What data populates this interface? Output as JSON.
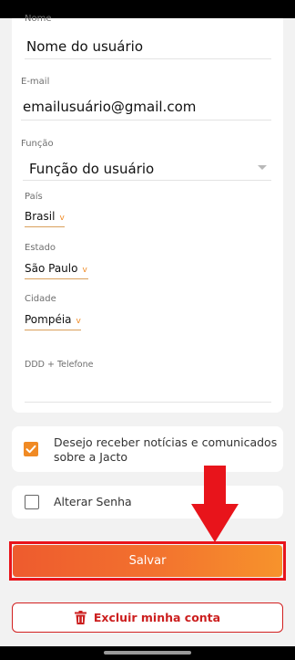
{
  "form": {
    "name_label": "Nome",
    "name_value": "Nome do usuário",
    "email_label": "E-mail",
    "email_value": "emailusuário@gmail.com",
    "role_label": "Função",
    "role_value": "Função do usuário",
    "country_label": "País",
    "country_value": "Brasil",
    "state_label": "Estado",
    "state_value": "São Paulo",
    "city_label": "Cidade",
    "city_value": "Pompéia",
    "phone_label": "DDD + Telefone",
    "phone_value": ""
  },
  "options": {
    "newsletter_text": "Desejo receber notícias e comunicados sobre a Jacto",
    "newsletter_checked": true,
    "change_password_text": "Alterar Senha",
    "change_password_checked": false
  },
  "actions": {
    "save_label": "Salvar",
    "delete_label": "Excluir minha conta"
  },
  "icons": {
    "caret": "v",
    "delete_icon": "trash-icon",
    "annotation_arrow": "down-arrow-icon"
  },
  "colors": {
    "accent": "#f08a24",
    "save_gradient_start": "#ee5b2e",
    "save_gradient_end": "#f7932c",
    "danger": "#cc1f1f",
    "annotation_red": "#e8141b"
  }
}
